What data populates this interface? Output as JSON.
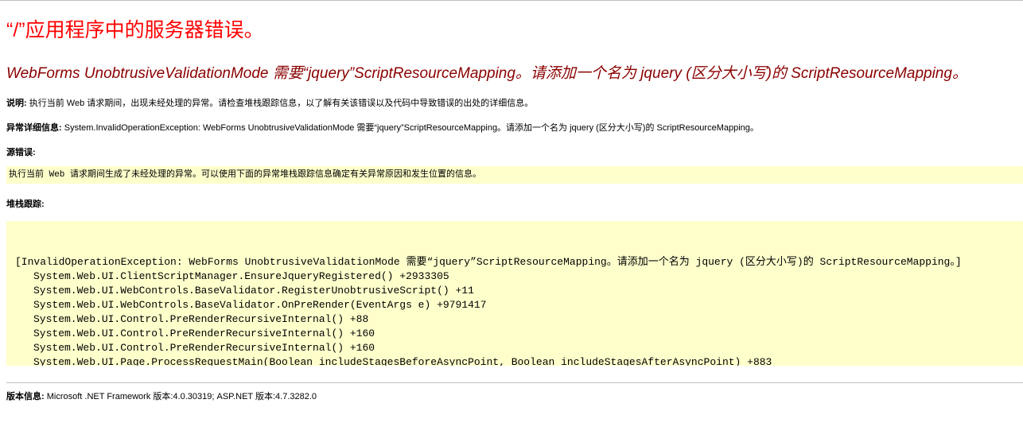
{
  "app_title": "“/”应用程序中的服务器错误。",
  "error_message": "WebForms UnobtrusiveValidationMode 需要“jquery”ScriptResourceMapping。请添加一个名为 jquery (区分大小写)的 ScriptResourceMapping。",
  "description": {
    "label": "说明:",
    "text": " 执行当前 Web 请求期间，出现未经处理的异常。请检查堆栈跟踪信息，以了解有关该错误以及代码中导致错误的出处的详细信息。"
  },
  "exception_details": {
    "label": "异常详细信息:",
    "text": " System.InvalidOperationException: WebForms UnobtrusiveValidationMode 需要“jquery”ScriptResourceMapping。请添加一个名为 jquery (区分大小写)的 ScriptResourceMapping。"
  },
  "source_error": {
    "label": "源错误:",
    "text": "执行当前 Web 请求期间生成了未经处理的异常。可以使用下面的异常堆栈跟踪信息确定有关异常原因和发生位置的信息。"
  },
  "stack_trace": {
    "label": "堆栈跟踪:",
    "lines": [
      "[InvalidOperationException: WebForms UnobtrusiveValidationMode 需要“jquery”ScriptResourceMapping。请添加一个名为 jquery (区分大小写)的 ScriptResourceMapping。]",
      "System.Web.UI.ClientScriptManager.EnsureJqueryRegistered() +2933305",
      "System.Web.UI.WebControls.BaseValidator.RegisterUnobtrusiveScript() +11",
      "System.Web.UI.WebControls.BaseValidator.OnPreRender(EventArgs e) +9791417",
      "System.Web.UI.Control.PreRenderRecursiveInternal() +88",
      "System.Web.UI.Control.PreRenderRecursiveInternal() +160",
      "System.Web.UI.Control.PreRenderRecursiveInternal() +160",
      "System.Web.UI.Page.ProcessRequestMain(Boolean includeStagesBeforeAsyncPoint, Boolean includeStagesAfterAsyncPoint) +883"
    ]
  },
  "version_info": {
    "label": "版本信息:",
    "text": " Microsoft .NET Framework 版本:4.0.30319; ASP.NET 版本:4.7.3282.0"
  },
  "colors": {
    "title": "#ff0000",
    "error_message": "#8b0000",
    "code_background": "#ffffcc",
    "rule": "#c0c0c0"
  }
}
